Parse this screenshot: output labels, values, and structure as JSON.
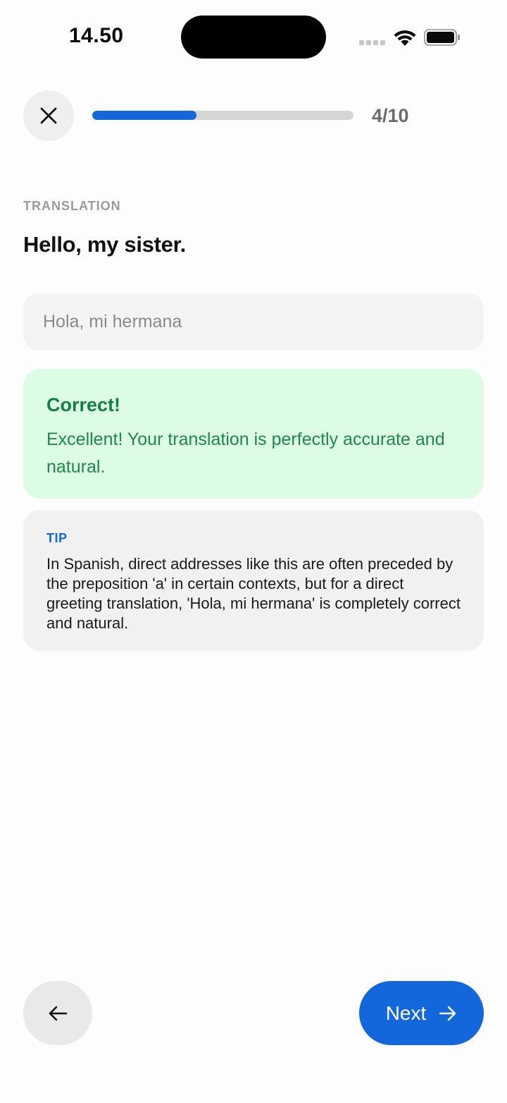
{
  "status_bar": {
    "time": "14.50",
    "icons": [
      "cellular-signal-icon",
      "wifi-icon",
      "battery-icon"
    ]
  },
  "header": {
    "close_icon": "close-icon",
    "progress": {
      "current": 4,
      "total": 10,
      "fraction": 0.4
    },
    "progress_label": "4/10"
  },
  "exercise": {
    "section_label": "TRANSLATION",
    "prompt": "Hello, my sister.",
    "answer": "Hola, mi hermana"
  },
  "feedback": {
    "title": "Correct!",
    "message": "Excellent! Your translation is perfectly accurate and natural."
  },
  "tip": {
    "label": "TIP",
    "text": "In Spanish, direct addresses like this are often preceded by the preposition 'a' in certain contexts, but for a direct greeting translation, 'Hola, mi hermana' is completely correct and natural."
  },
  "navigation": {
    "back_icon": "arrow-left-icon",
    "next_label": "Next",
    "next_icon": "arrow-right-icon"
  },
  "colors": {
    "accent": "#1466db",
    "success_bg": "#dcfce4",
    "success_text": "#148045",
    "tip_bg": "#f1f1f1",
    "progress_track": "#d6d6d6"
  }
}
